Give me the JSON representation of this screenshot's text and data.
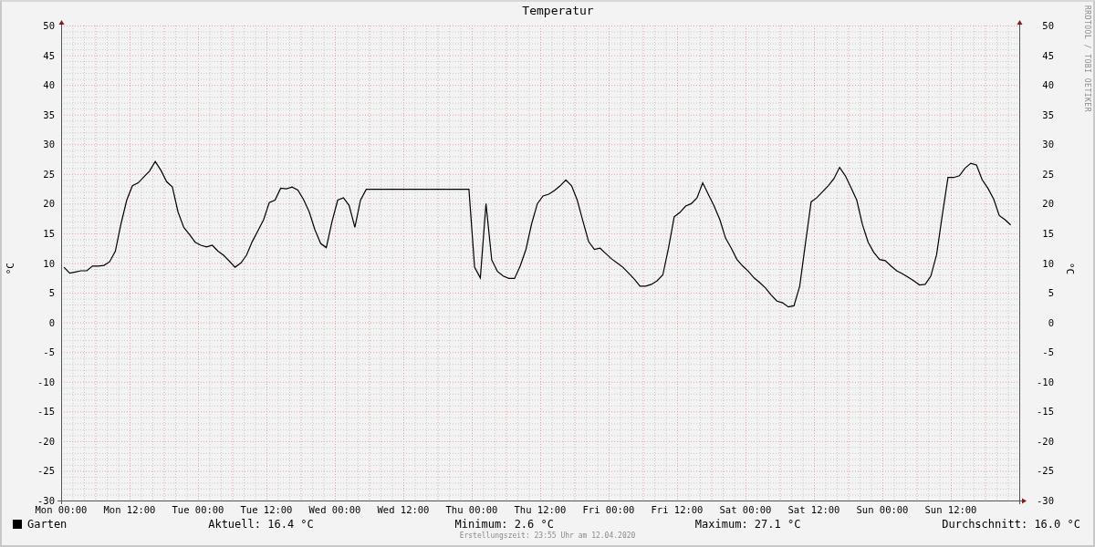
{
  "graph": {
    "watermark": "RRDTOOL / TOBI OETIKER",
    "chart_data": {
      "type": "line",
      "title": "Temperatur",
      "ylabel": "°C",
      "categories": [
        "Mon 00:00",
        null,
        null,
        null,
        null,
        null,
        null,
        null,
        null,
        null,
        null,
        null,
        "Mon 12:00",
        null,
        null,
        null,
        null,
        null,
        null,
        null,
        null,
        null,
        null,
        null,
        "Tue 00:00",
        null,
        null,
        null,
        null,
        null,
        null,
        null,
        null,
        null,
        null,
        null,
        "Tue 12:00",
        null,
        null,
        null,
        null,
        null,
        null,
        null,
        null,
        null,
        null,
        null,
        "Wed 00:00",
        null,
        null,
        null,
        null,
        null,
        null,
        null,
        null,
        null,
        null,
        null,
        "Wed 12:00",
        null,
        null,
        null,
        null,
        null,
        null,
        null,
        null,
        null,
        null,
        null,
        "Thu 00:00",
        null,
        null,
        null,
        null,
        null,
        null,
        null,
        null,
        null,
        null,
        null,
        "Thu 12:00",
        null,
        null,
        null,
        null,
        null,
        null,
        null,
        null,
        null,
        null,
        null,
        "Fri 00:00",
        null,
        null,
        null,
        null,
        null,
        null,
        null,
        null,
        null,
        null,
        null,
        "Fri 12:00",
        null,
        null,
        null,
        null,
        null,
        null,
        null,
        null,
        null,
        null,
        null,
        "Sat 00:00",
        null,
        null,
        null,
        null,
        null,
        null,
        null,
        null,
        null,
        null,
        null,
        "Sat 12:00",
        null,
        null,
        null,
        null,
        null,
        null,
        null,
        null,
        null,
        null,
        null,
        "Sun 00:00",
        null,
        null,
        null,
        null,
        null,
        null,
        null,
        null,
        null,
        null,
        null,
        "Sun 12:00",
        null,
        null,
        null,
        null,
        null,
        null,
        null,
        null,
        null,
        null,
        null
      ],
      "series": [
        {
          "name": "Garten",
          "color": "#000000",
          "values": [
            9.3,
            8.3,
            8.5,
            8.7,
            8.7,
            9.5,
            9.5,
            9.6,
            10.2,
            12,
            16.6,
            20.6,
            23,
            23.5,
            24.5,
            25.5,
            27.1,
            25.6,
            23.7,
            22.8,
            18.6,
            16,
            14.8,
            13.5,
            13,
            12.7,
            13,
            12,
            11.3,
            10.3,
            9.3,
            10,
            11.3,
            13.6,
            15.4,
            17.3,
            20.2,
            20.6,
            22.6,
            22.5,
            22.8,
            22.3,
            20.7,
            18.6,
            15.6,
            13.3,
            12.6,
            17,
            20.6,
            21,
            19.7,
            16,
            20.6,
            22.4,
            22.4,
            22.4,
            22.4,
            22.4,
            22.4,
            22.4,
            22.4,
            22.4,
            22.4,
            22.4,
            22.4,
            22.4,
            22.4,
            22.4,
            22.4,
            22.4,
            22.4,
            22.4,
            9.3,
            7.5,
            20,
            10.5,
            8.6,
            7.8,
            7.4,
            7.4,
            9.5,
            12.3,
            16.6,
            20,
            21.3,
            21.6,
            22.2,
            23,
            24,
            23,
            20.6,
            17,
            13.6,
            12.3,
            12.5,
            11.6,
            10.7,
            10,
            9.3,
            8.3,
            7.3,
            6.1,
            6.1,
            6.4,
            7,
            8,
            12.5,
            17.8,
            18.5,
            19.6,
            20,
            21,
            23.5,
            21.5,
            19.6,
            17.3,
            14.2,
            12.5,
            10.6,
            9.5,
            8.6,
            7.5,
            6.7,
            5.8,
            4.6,
            3.6,
            3.3,
            2.6,
            2.8,
            6.1,
            13.2,
            20.3,
            21,
            22,
            23,
            24.2,
            26.1,
            24.7,
            22.7,
            20.6,
            16.5,
            13.5,
            11.8,
            10.6,
            10.4,
            9.5,
            8.7,
            8.2,
            7.6,
            7,
            6.3,
            6.4,
            7.8,
            11.4,
            18,
            24.4,
            24.4,
            24.7,
            26,
            26.8,
            26.5,
            24,
            22.6,
            20.8,
            18,
            17.3,
            16.4,
            null
          ]
        }
      ],
      "ylim": [
        -30,
        50
      ],
      "grid": true,
      "yticks": [
        -30,
        -25,
        -20,
        -15,
        -10,
        -5,
        0,
        5,
        10,
        15,
        20,
        25,
        30,
        35,
        40,
        45,
        50
      ]
    },
    "right_axis_labels": [
      "50",
      "45",
      "40",
      "35",
      "30",
      "25",
      "20",
      "15",
      "10",
      "5",
      "0",
      "-5",
      "-10",
      "-15",
      "-20",
      "-25",
      "-30"
    ],
    "legend": {
      "current": "Aktuell: 16.4 °C",
      "minimum": "Minimum: 2.6 °C",
      "maximum": "Maximum: 27.1 °C",
      "average": "Durchschnitt: 16.0 °C"
    },
    "footer": "Erstellungszeit: 23:55 Uhr am 12.04.2020"
  }
}
